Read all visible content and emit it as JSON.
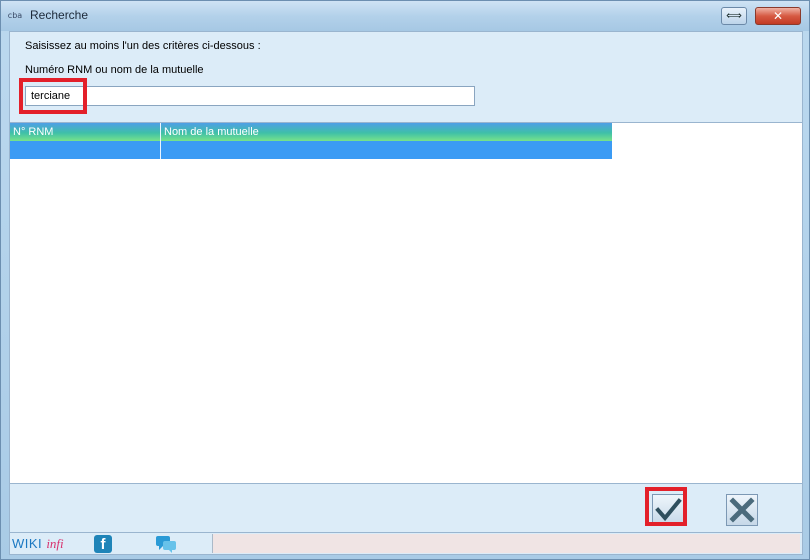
{
  "window": {
    "app_icon_text": "cba",
    "title": "Recherche",
    "restore_glyph": "⟺",
    "close_glyph": "✕"
  },
  "form": {
    "criteria_label": "Saisissez au moins l'un des critères ci-dessous :",
    "field_label": "Numéro RNM ou nom de la mutuelle",
    "search_value": "terciane"
  },
  "grid": {
    "columns": [
      "N° RNM",
      "Nom de la mutuelle"
    ],
    "rows": [
      [
        "",
        ""
      ]
    ]
  },
  "buttons": {
    "ok_icon": "check-icon",
    "cancel_icon": "close-x-icon"
  },
  "footer": {
    "wiki_part1": "WIKI",
    "wiki_part2": "infi",
    "facebook_glyph": "f"
  },
  "colors": {
    "highlight": "#e3202a",
    "header_gradient_top": "#4f9fe6",
    "header_gradient_bottom": "#78e28a",
    "selected_row": "#3b9bf4",
    "check": "#2f4f5e",
    "cross": "#4b6b7c"
  }
}
